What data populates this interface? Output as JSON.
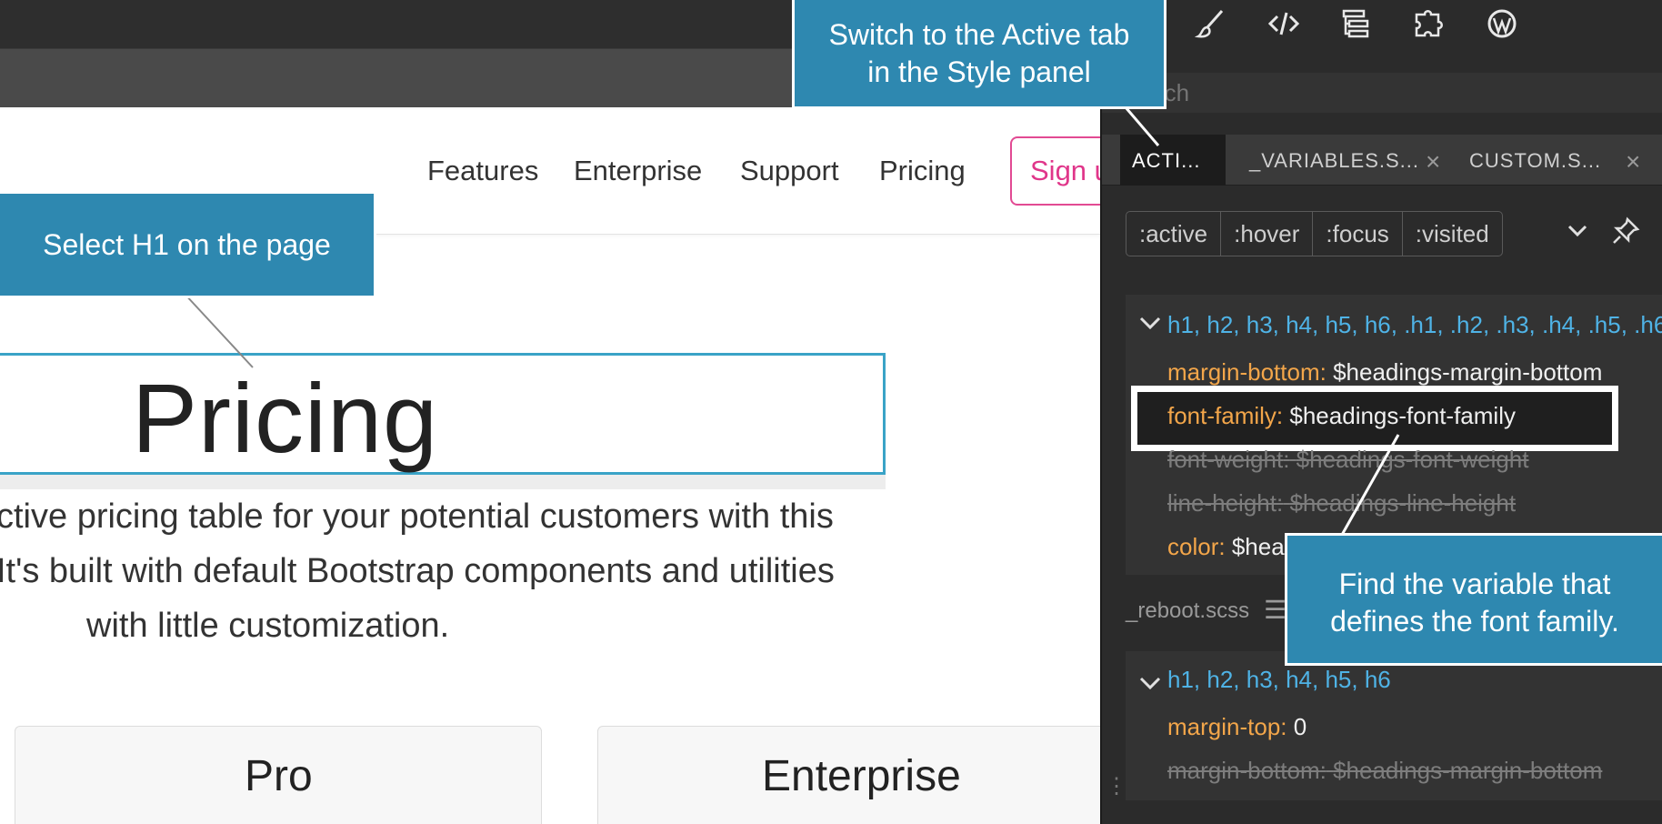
{
  "nav": {
    "links": [
      "Features",
      "Enterprise",
      "Support",
      "Pricing"
    ],
    "signup_label": "Sign u"
  },
  "hero": {
    "heading": "Pricing",
    "lead_lines": [
      "ctive pricing table for your potential customers with this",
      "It's built with default Bootstrap components and utilities",
      "with little customization."
    ]
  },
  "cards": [
    "Pro",
    "Enterprise"
  ],
  "panel": {
    "search_placeholder": "rch",
    "tabs": [
      "ACTI...",
      "_VARIABLES.S...",
      "CUSTOM.S..."
    ],
    "pseudo_states": [
      ":active",
      ":hover",
      ":focus",
      ":visited"
    ],
    "rule1": {
      "selector": "h1, h2, h3, h4, h5, h6, .h1, .h2, .h3, .h4, .h5, .h6",
      "declarations": [
        {
          "prop": "margin-bottom",
          "val": "$headings-margin-bottom",
          "struck": false
        },
        {
          "prop": "font-family",
          "val": "$headings-font-family",
          "struck": false
        },
        {
          "prop": "font-weight",
          "val": "$headings-font-weight",
          "struck": true
        },
        {
          "prop": "line-height",
          "val": "$headings-line-height",
          "struck": true
        },
        {
          "prop": "color",
          "val": "$hea",
          "struck": false
        }
      ]
    },
    "file_label": "_reboot.scss",
    "rule2": {
      "selector": "h1, h2, h3, h4, h5, h6",
      "declarations": [
        {
          "prop": "margin-top",
          "val": "0",
          "struck": false
        },
        {
          "prop": "margin-bottom",
          "val": "$headings-margin-bottom",
          "struck": true
        }
      ]
    }
  },
  "callouts": {
    "active_tab": [
      "Switch to the Active tab",
      "in the Style panel"
    ],
    "select_h1": [
      "Select H1 on the page"
    ],
    "find_variable": [
      "Find the variable that",
      "defines the font family."
    ]
  },
  "colors": {
    "callout_bg": "#2e88b0",
    "selector_blue": "#4fb3e6",
    "property_orange": "#f3a64a",
    "signup_pink": "#e0368a",
    "selection_blue": "#3aa3c7"
  }
}
